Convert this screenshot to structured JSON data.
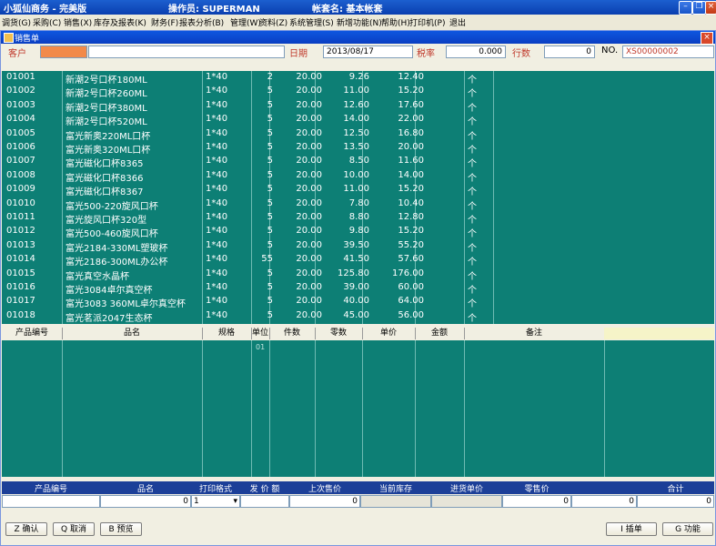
{
  "app": {
    "title": "小狐仙商务 - 完美版",
    "operator": "操作员: SUPERMAN",
    "account": "帐套名: 基本帐套"
  },
  "menu": [
    "调货(G)",
    "采购(C)",
    "销售(X)",
    "库存及报表(K)",
    "财务(F)",
    "报表分析(B)",
    "管理(W)",
    "资料(Z)",
    "系统管理(S)",
    "新增功能(N)",
    "帮助(H)",
    "打印机(P)",
    "退出"
  ],
  "window": {
    "title": "销售单"
  },
  "form": {
    "customer_label": "客户",
    "date_label": "日期",
    "date_value": "2013/08/17",
    "tax_label": "税率",
    "tax_value": "0.000",
    "rows_label": "行数",
    "rows_value": "0",
    "no_label": "NO.",
    "no_value": "XS00000002"
  },
  "products": [
    {
      "code": "01001",
      "name": "新潮2号口杯180ML",
      "spec": "1*40",
      "qty": "2",
      "pack": "20.00",
      "cost": "9.26",
      "price": "12.40",
      "unit": "个"
    },
    {
      "code": "01002",
      "name": "新潮2号口杯260ML",
      "spec": "1*40",
      "qty": "5",
      "pack": "20.00",
      "cost": "11.00",
      "price": "15.20",
      "unit": "个"
    },
    {
      "code": "01003",
      "name": "新潮2号口杯380ML",
      "spec": "1*40",
      "qty": "5",
      "pack": "20.00",
      "cost": "12.60",
      "price": "17.60",
      "unit": "个"
    },
    {
      "code": "01004",
      "name": "新潮2号口杯520ML",
      "spec": "1*40",
      "qty": "5",
      "pack": "20.00",
      "cost": "14.00",
      "price": "22.00",
      "unit": "个"
    },
    {
      "code": "01005",
      "name": "富光新奥220ML口杯",
      "spec": "1*40",
      "qty": "5",
      "pack": "20.00",
      "cost": "12.50",
      "price": "16.80",
      "unit": "个"
    },
    {
      "code": "01006",
      "name": "富光新奥320ML口杯",
      "spec": "1*40",
      "qty": "5",
      "pack": "20.00",
      "cost": "13.50",
      "price": "20.00",
      "unit": "个"
    },
    {
      "code": "01007",
      "name": "富光磁化口杯8365",
      "spec": "1*40",
      "qty": "5",
      "pack": "20.00",
      "cost": "8.50",
      "price": "11.60",
      "unit": "个"
    },
    {
      "code": "01008",
      "name": "富光磁化口杯8366",
      "spec": "1*40",
      "qty": "5",
      "pack": "20.00",
      "cost": "10.00",
      "price": "14.00",
      "unit": "个"
    },
    {
      "code": "01009",
      "name": "富光磁化口杯8367",
      "spec": "1*40",
      "qty": "5",
      "pack": "20.00",
      "cost": "11.00",
      "price": "15.20",
      "unit": "个"
    },
    {
      "code": "01010",
      "name": "富光500-220旋风口杯",
      "spec": "1*40",
      "qty": "5",
      "pack": "20.00",
      "cost": "7.80",
      "price": "10.40",
      "unit": "个"
    },
    {
      "code": "01011",
      "name": "富光旋风口杯320型",
      "spec": "1*40",
      "qty": "5",
      "pack": "20.00",
      "cost": "8.80",
      "price": "12.80",
      "unit": "个"
    },
    {
      "code": "01012",
      "name": "富光500-460旋风口杯",
      "spec": "1*40",
      "qty": "5",
      "pack": "20.00",
      "cost": "9.80",
      "price": "15.20",
      "unit": "个"
    },
    {
      "code": "01013",
      "name": "富光2184-330ML塑玻杯",
      "spec": "1*40",
      "qty": "5",
      "pack": "20.00",
      "cost": "39.50",
      "price": "55.20",
      "unit": "个"
    },
    {
      "code": "01014",
      "name": "富光2186-300ML办公杯",
      "spec": "1*40",
      "qty": "55",
      "pack": "20.00",
      "cost": "41.50",
      "price": "57.60",
      "unit": "个"
    },
    {
      "code": "01015",
      "name": "富光真空水晶杯",
      "spec": "1*40",
      "qty": "5",
      "pack": "20.00",
      "cost": "125.80",
      "price": "176.00",
      "unit": "个"
    },
    {
      "code": "01016",
      "name": "富光3084卓尔真空杯",
      "spec": "1*40",
      "qty": "5",
      "pack": "20.00",
      "cost": "39.00",
      "price": "60.00",
      "unit": "个"
    },
    {
      "code": "01017",
      "name": "富光3083 360ML卓尔真空杯",
      "spec": "1*40",
      "qty": "5",
      "pack": "20.00",
      "cost": "40.00",
      "price": "64.00",
      "unit": "个"
    },
    {
      "code": "01018",
      "name": "富光茗派2047生态杯",
      "spec": "1*40",
      "qty": "5",
      "pack": "20.00",
      "cost": "45.00",
      "price": "56.00",
      "unit": "个"
    }
  ],
  "entry_headers": [
    "产品编号",
    "品名",
    "规格",
    "单位",
    "件数",
    "零数",
    "单价",
    "金额",
    "备注"
  ],
  "entry_unit_value": "01",
  "summary": {
    "headers": [
      "产品编号",
      "品名",
      "打印格式",
      "发 价 额",
      "上次售价",
      "当前库存",
      "进货单价",
      "零售价",
      "",
      "合计"
    ],
    "values": [
      "",
      "0",
      "1",
      "",
      "0",
      "",
      "",
      "0",
      "0",
      "0"
    ]
  },
  "buttons": {
    "confirm": "Z 确认",
    "cancel": "Q 取消",
    "preview": "B 预览",
    "insert": "I 插单",
    "function": "G 功能"
  }
}
